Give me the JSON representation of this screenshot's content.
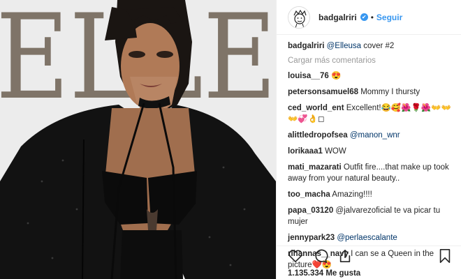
{
  "media": {
    "magazine_title": "ELLE"
  },
  "header": {
    "username": "badgalriri",
    "verified_glyph": "✔",
    "separator": "•",
    "follow_label": "Seguir"
  },
  "caption": {
    "user": "badgalriri",
    "mention": "@Elleusa",
    "text": " cover #2"
  },
  "load_more": "Cargar más comentarios",
  "comments": [
    {
      "user": "louisa__76",
      "text": " 😍"
    },
    {
      "user": "petersonsamuel68",
      "text": " Mommy I thursty"
    },
    {
      "user": "ced_world_ent",
      "text": " Excellent!😂🥰🌺🌹🌺👐👐👐💞👌◻"
    },
    {
      "user": "alittledropofsea",
      "text": " @manon_wnr"
    },
    {
      "user": "lorikaaa1",
      "text": " WOW"
    },
    {
      "user": "mati_mazarati",
      "text": " Outfit fire....that make up took away from your natural beauty.."
    },
    {
      "user": "too_macha",
      "text": " Amazing!!!!"
    },
    {
      "user": "papa_03120",
      "text": " @jalvarezoficial te va picar tu mujer"
    },
    {
      "user": "jennypark23",
      "text": " @perlaescalante"
    },
    {
      "user": "rihannas__navy",
      "text": " I can se a Queen in the picture❤️😍"
    }
  ],
  "likes": "1.135.334 Me gusta",
  "icons": [
    "heart-icon",
    "comment-icon",
    "share-icon",
    "bookmark-icon"
  ]
}
